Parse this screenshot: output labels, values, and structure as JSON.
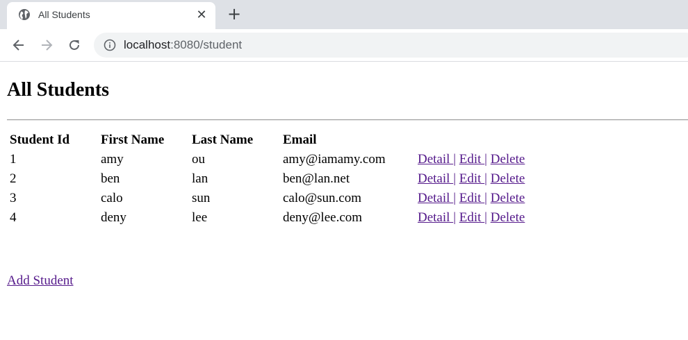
{
  "browser": {
    "tab_title": "All Students",
    "url_host": "localhost",
    "url_rest": ":8080/student"
  },
  "page": {
    "title": "All Students",
    "columns": [
      "Student Id",
      "First Name",
      "Last Name",
      "Email"
    ],
    "rows": [
      {
        "id": "1",
        "first": "amy",
        "last": "ou",
        "email": "amy@iamamy.com"
      },
      {
        "id": "2",
        "first": "ben",
        "last": "lan",
        "email": "ben@lan.net"
      },
      {
        "id": "3",
        "first": "calo",
        "last": "sun",
        "email": "calo@sun.com"
      },
      {
        "id": "4",
        "first": "deny",
        "last": "lee",
        "email": "deny@lee.com"
      }
    ],
    "actions": {
      "detail": "Detail ",
      "edit": "Edit ",
      "delete": "Delete",
      "separator": "|"
    },
    "add_link": "Add Student"
  },
  "colors": {
    "tabstrip_bg": "#dee1e6",
    "omnibox_bg": "#f1f3f4",
    "link_visited": "#551a8b"
  },
  "icons": {
    "favicon": "globe-icon",
    "close": "close-icon",
    "new_tab": "plus-icon",
    "back": "arrow-left-icon",
    "forward": "arrow-right-icon",
    "reload": "reload-icon",
    "site_info": "info-icon"
  }
}
